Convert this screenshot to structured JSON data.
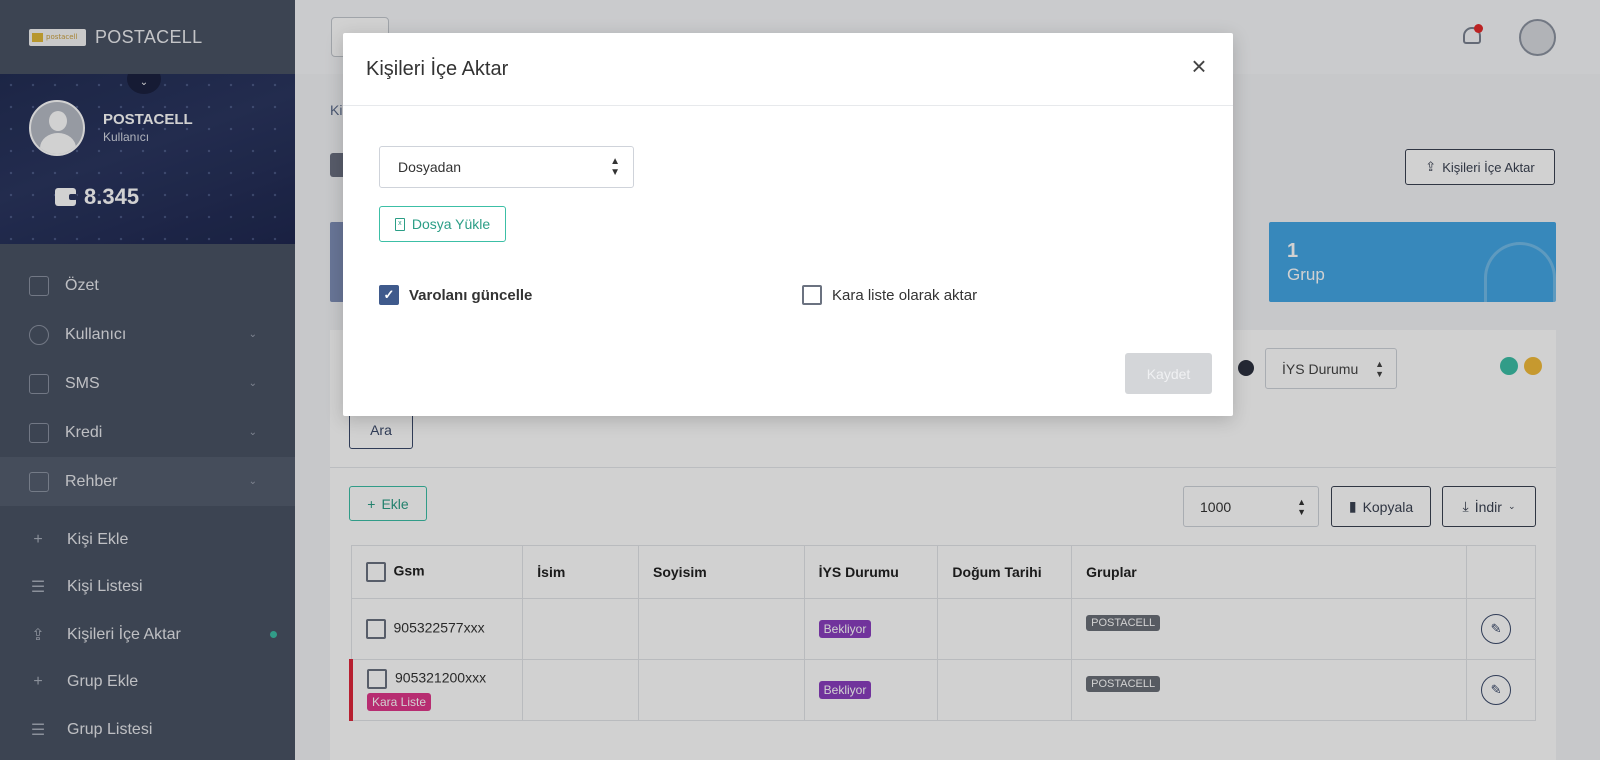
{
  "sidebar": {
    "brand": "POSTACELL",
    "logo_text": "postacell",
    "user_name": "POSTACELL",
    "user_role": "Kullanıcı",
    "balance": "8.345",
    "menu": [
      {
        "label": "Özet"
      },
      {
        "label": "Kullanıcı"
      },
      {
        "label": "SMS"
      },
      {
        "label": "Kredi"
      },
      {
        "label": "Rehber"
      }
    ],
    "submenu": [
      {
        "label": "Kişi Ekle"
      },
      {
        "label": "Kişi Listesi"
      },
      {
        "label": "Kişileri İçe Aktar"
      },
      {
        "label": "Grup Ekle"
      },
      {
        "label": "Grup Listesi"
      }
    ]
  },
  "main": {
    "breadcrumb": "Ki",
    "import_button": "Kişileri İçe Aktar",
    "stat_group": {
      "value": "1",
      "label": "Grup"
    },
    "iys_filter": "İYS Durumu",
    "search_button": "Ara",
    "add_button": "Ekle",
    "page_size": "1000",
    "copy_button": "Kopyala",
    "download_button": "İndir",
    "table": {
      "headers": [
        "Gsm",
        "İsim",
        "Soyisim",
        "İYS Durumu",
        "Doğum Tarihi",
        "Gruplar"
      ],
      "rows": [
        {
          "gsm": "905322577xxx",
          "iys": "Bekliyor",
          "group": "POSTACELL",
          "blacklist": ""
        },
        {
          "gsm": "905321200xxx",
          "iys": "Bekliyor",
          "group": "POSTACELL",
          "blacklist": "Kara Liste"
        }
      ]
    }
  },
  "modal": {
    "title": "Kişileri İçe Aktar",
    "source_select": "Dosyadan",
    "upload_button": "Dosya Yükle",
    "update_existing_label": "Varolanı güncelle",
    "update_existing_checked": true,
    "blacklist_label": "Kara liste olarak aktar",
    "blacklist_checked": false,
    "save_button": "Kaydet"
  },
  "colors": {
    "accent_teal": "#3cbfa6",
    "sidebar_bg": "#4a5364",
    "blue_stat": "#44a6e4",
    "badge_purple": "#8a3fbf",
    "blacklist_pink": "#e0378a"
  }
}
